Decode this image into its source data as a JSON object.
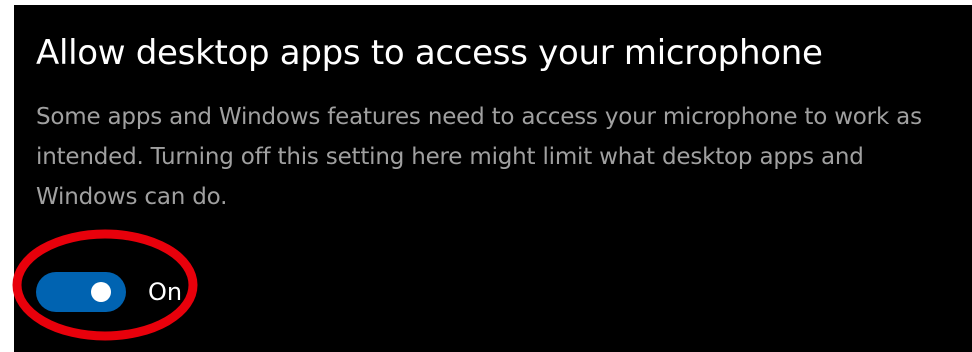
{
  "section": {
    "title": "Allow desktop apps to access your microphone",
    "description": "Some apps and Windows features need to access your microphone to work as intended. Turning off this setting here might limit what desktop apps and Windows can do."
  },
  "toggle": {
    "state_label": "On",
    "is_on": true
  },
  "colors": {
    "background": "#000000",
    "title_text": "#ffffff",
    "description_text": "#a0a0a0",
    "toggle_on": "#0063b1",
    "annotation_circle": "#e8000b"
  }
}
